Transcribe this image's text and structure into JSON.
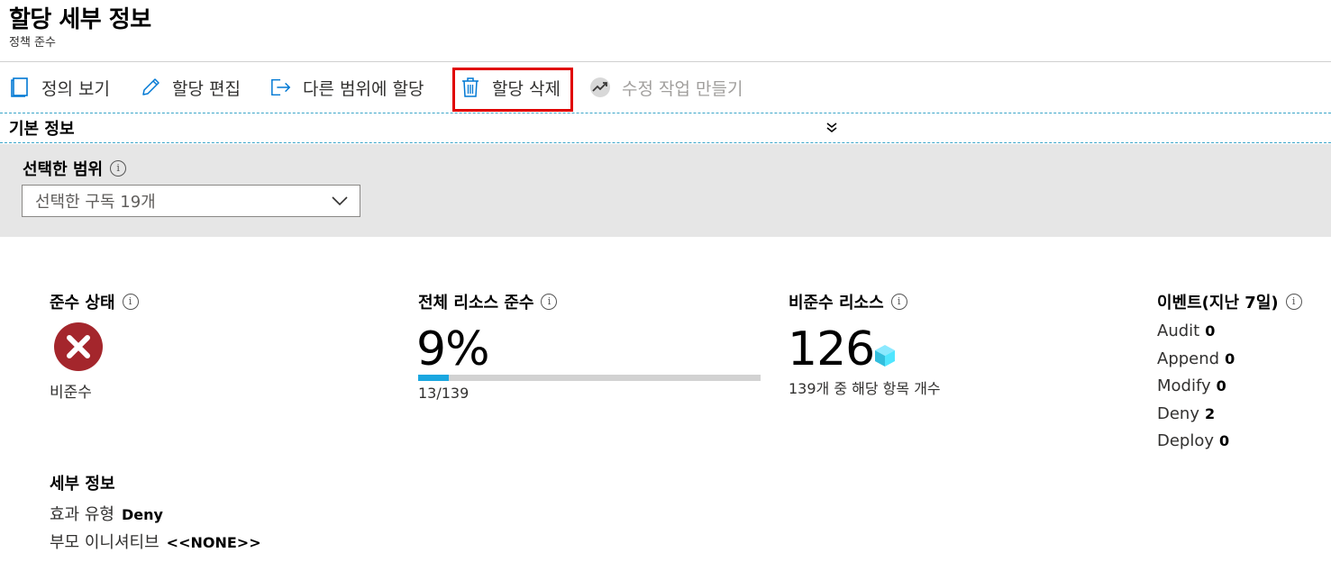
{
  "header": {
    "title": "할당 세부 정보",
    "subtitle": "정책 준수"
  },
  "toolbar": {
    "view_definition": "정의 보기",
    "edit_assignment": "할당 편집",
    "assign_to_another_scope": "다른 범위에 할당",
    "delete_assignment": "할당 삭제",
    "create_remediation_task": "수정 작업 만들기"
  },
  "essentials": {
    "label": "기본 정보"
  },
  "scope": {
    "label": "선택한 범위",
    "selected_value": "선택한 구독 19개"
  },
  "compliance_state": {
    "label": "준수 상태",
    "value": "비준수"
  },
  "overall_compliance": {
    "label": "전체 리소스 준수",
    "percent_text": "9%",
    "fraction_text": "13/139",
    "progress_percent": 9
  },
  "noncompliant_resources": {
    "label": "비준수 리소스",
    "count": "126",
    "caption": "139개 중 해당 항목 개수"
  },
  "events": {
    "label": "이벤트(지난 7일)",
    "items": [
      {
        "name": "Audit",
        "count": "0"
      },
      {
        "name": "Append",
        "count": "0"
      },
      {
        "name": "Modify",
        "count": "0"
      },
      {
        "name": "Deny",
        "count": "2"
      },
      {
        "name": "Deploy",
        "count": "0"
      }
    ]
  },
  "details": {
    "label": "세부 정보",
    "effect_type_label": "효과 유형",
    "effect_type_value": "Deny",
    "parent_initiative_label": "부모 이니셔티브",
    "parent_initiative_value": "<<NONE>>"
  },
  "colors": {
    "accent": "#0078d4",
    "highlight_box": "#e00000",
    "fail_red": "#a4262c",
    "progress": "#1aa7e0",
    "cube": "#50e6ff"
  },
  "icons": {
    "view_definition": "book-icon",
    "edit_assignment": "pencil-icon",
    "assign_to_another_scope": "sign-out-arrow-icon",
    "delete_assignment": "trash-icon",
    "create_remediation_task": "trend-icon",
    "collapse": "double-chevron-down-icon",
    "compliance_fail": "error-x-circle-icon",
    "resource": "cube-icon"
  }
}
